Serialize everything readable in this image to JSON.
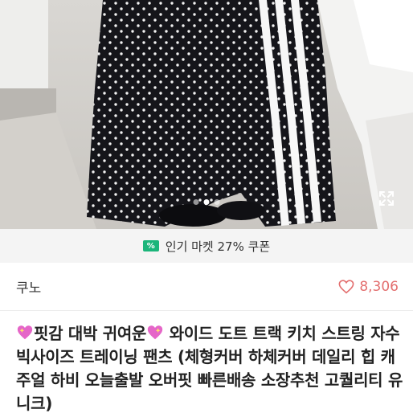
{
  "carousel": {
    "total": 3,
    "active_index": 1
  },
  "coupon": {
    "icon": "coupon-tag-icon",
    "icon_text": "%",
    "text": "인기 마켓 27% 쿠폰",
    "accent": "#1bb57a"
  },
  "seller": {
    "name": "쿠노",
    "like_icon": "heart-outline-icon",
    "like_count": "8,306",
    "like_color": "#e36f6f"
  },
  "product": {
    "title_lead": "핏감 대박 귀여운",
    "title_rest": " 와이드 도트 트랙 키치 스트링 자수 빅사이즈 트레이닝 팬츠 (체형커버 하체커버 데일리 힙 캐주얼 하비 오늘출발 오버핏 빠른배송 소장추천 고퀄리티 유니크)",
    "emoji": "sparkling-heart-icon"
  }
}
